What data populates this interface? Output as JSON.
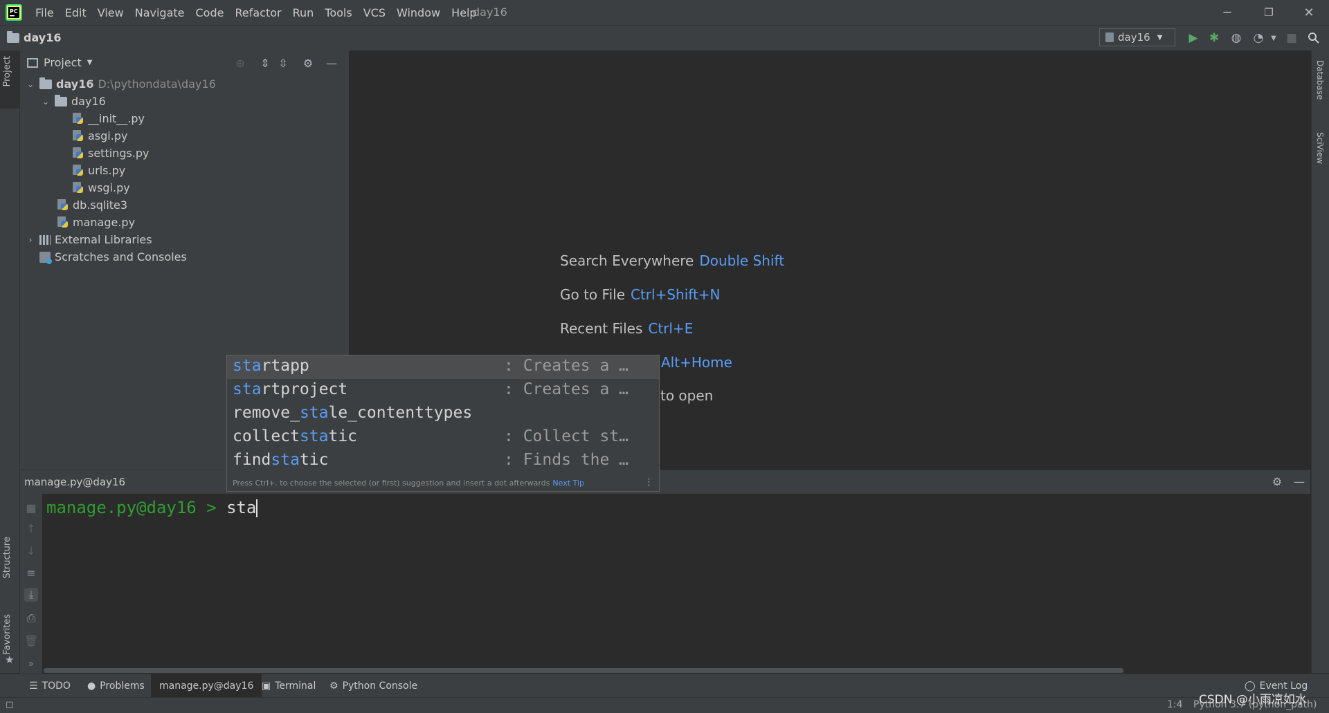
{
  "window": {
    "title": "day16",
    "menu": [
      "File",
      "Edit",
      "View",
      "Navigate",
      "Code",
      "Refactor",
      "Run",
      "Tools",
      "VCS",
      "Window",
      "Help"
    ],
    "controls": [
      "─",
      "❐",
      "✕"
    ]
  },
  "navbar": {
    "crumb": "day16",
    "run_config": "day16"
  },
  "left_strip": {
    "project": "Project",
    "structure": "Structure",
    "favorites": "Favorites"
  },
  "right_strip": {
    "database": "Database",
    "sciview": "SciView"
  },
  "project_panel": {
    "title": "Project",
    "tree": [
      {
        "label": "day16",
        "path": "D:\\pythondata\\day16"
      },
      {
        "label": "day16"
      },
      {
        "label": "__init__.py"
      },
      {
        "label": "asgi.py"
      },
      {
        "label": "settings.py"
      },
      {
        "label": "urls.py"
      },
      {
        "label": "wsgi.py"
      },
      {
        "label": "db.sqlite3"
      },
      {
        "label": "manage.py"
      },
      {
        "label": "External Libraries"
      },
      {
        "label": "Scratches and Consoles"
      }
    ]
  },
  "editor_hints": [
    {
      "text": "Search Everywhere",
      "key": "Double Shift"
    },
    {
      "text": "Go to File",
      "key": "Ctrl+Shift+N"
    },
    {
      "text": "Recent Files",
      "key": "Ctrl+E"
    },
    {
      "text": "",
      "key": "Alt+Home"
    },
    {
      "text": "to open",
      "key": ""
    }
  ],
  "run_panel": {
    "tab_title": "manage.py@day16",
    "prompt": "manage.py@day16 > ",
    "typed": "sta"
  },
  "completion": {
    "items": [
      {
        "before": "",
        "match": "sta",
        "after": "rtapp",
        "desc": ": Creates a …"
      },
      {
        "before": "",
        "match": "sta",
        "after": "rtproject",
        "desc": ": Creates a …"
      },
      {
        "before": "remove_",
        "match": "sta",
        "after": "le_contenttypes",
        "desc": ""
      },
      {
        "before": "collect",
        "match": "sta",
        "after": "tic",
        "desc": ": Collect st…"
      },
      {
        "before": "find",
        "match": "sta",
        "after": "tic",
        "desc": ": Finds the …"
      }
    ],
    "footer": "Press Ctrl+. to choose the selected (or first) suggestion and insert a dot afterwards",
    "next_tip": "Next Tip"
  },
  "bottom_tabs": [
    "TODO",
    "Problems",
    "manage.py@day16",
    "Terminal",
    "Python Console"
  ],
  "status": {
    "event_log": "Event Log",
    "position": "1:4",
    "interpreter": "Python 3.7 (python_path)",
    "watermark": "CSDN @小雨凉如水"
  },
  "colors": {
    "accent": "#589df6",
    "prompt_green": "#2e9e2e",
    "run_green": "#59a869",
    "bg": "#2b2b2b",
    "panel": "#3c3f41"
  },
  "icons": [
    "pycharm-logo-icon",
    "folder-icon",
    "python-file-icon",
    "search-icon",
    "run-icon",
    "debug-icon",
    "coverage-icon",
    "profile-icon",
    "stop-icon",
    "gear-icon",
    "minimize-icon",
    "locate-icon",
    "expand-all-icon",
    "collapse-all-icon"
  ]
}
